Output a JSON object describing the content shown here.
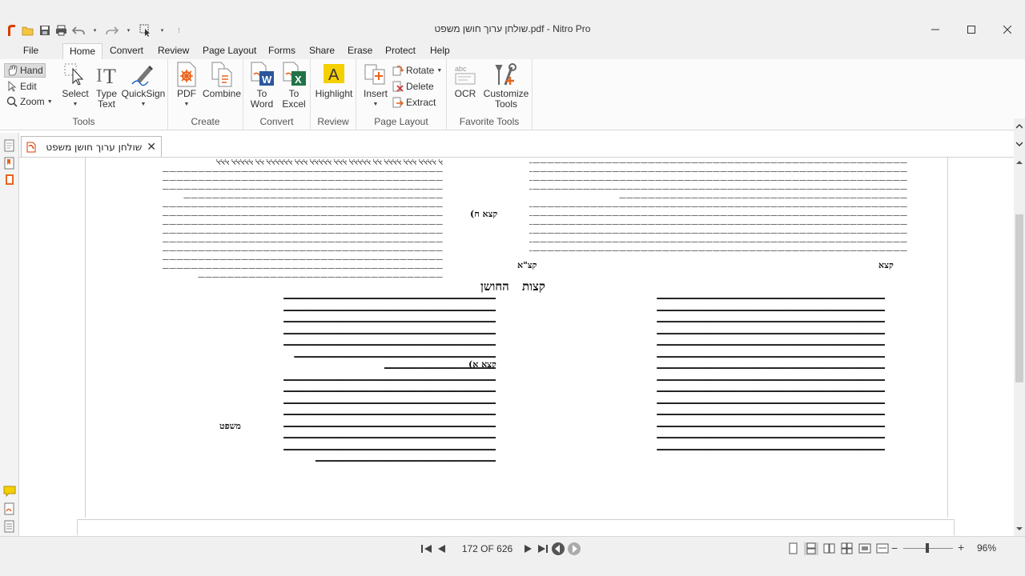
{
  "window": {
    "title": "שולחן ערוך חושן משפט.pdf - Nitro Pro",
    "doc_tab": "שולחן ערוך חושן משפט"
  },
  "menu_tabs": [
    "File",
    "Home",
    "Convert",
    "Review",
    "Page Layout",
    "Forms",
    "Share",
    "Erase",
    "Protect",
    "Help"
  ],
  "ribbon": {
    "tools": {
      "title": "Tools",
      "hand": "Hand",
      "edit": "Edit",
      "zoom": "Zoom",
      "select": "Select",
      "type_text": "Type\nText",
      "quicksign": "QuickSign"
    },
    "create": {
      "title": "Create",
      "pdf": "PDF",
      "combine": "Combine"
    },
    "convert": {
      "title": "Convert",
      "to_word": "To\nWord",
      "to_excel": "To\nExcel"
    },
    "review": {
      "title": "Review",
      "highlight": "Highlight"
    },
    "page_layout": {
      "title": "Page Layout",
      "insert": "Insert",
      "rotate": "Rotate",
      "delete": "Delete",
      "extract": "Extract"
    },
    "favorite": {
      "title": "Favorite Tools",
      "ocr": "OCR",
      "customize": "Customize\nTools"
    }
  },
  "document": {
    "heading_right": "קצות",
    "heading_left": "החושן",
    "marker_1": "קצא",
    "marker_2": "קצ\"א",
    "label_1": "קצא א)",
    "label_2": "קצא ח)",
    "label_3": "משפט"
  },
  "status": {
    "page": "172 OF 626",
    "zoom": "96%"
  },
  "colors": {
    "accent": "#d83b01",
    "chrome": "#f0f0f0"
  }
}
